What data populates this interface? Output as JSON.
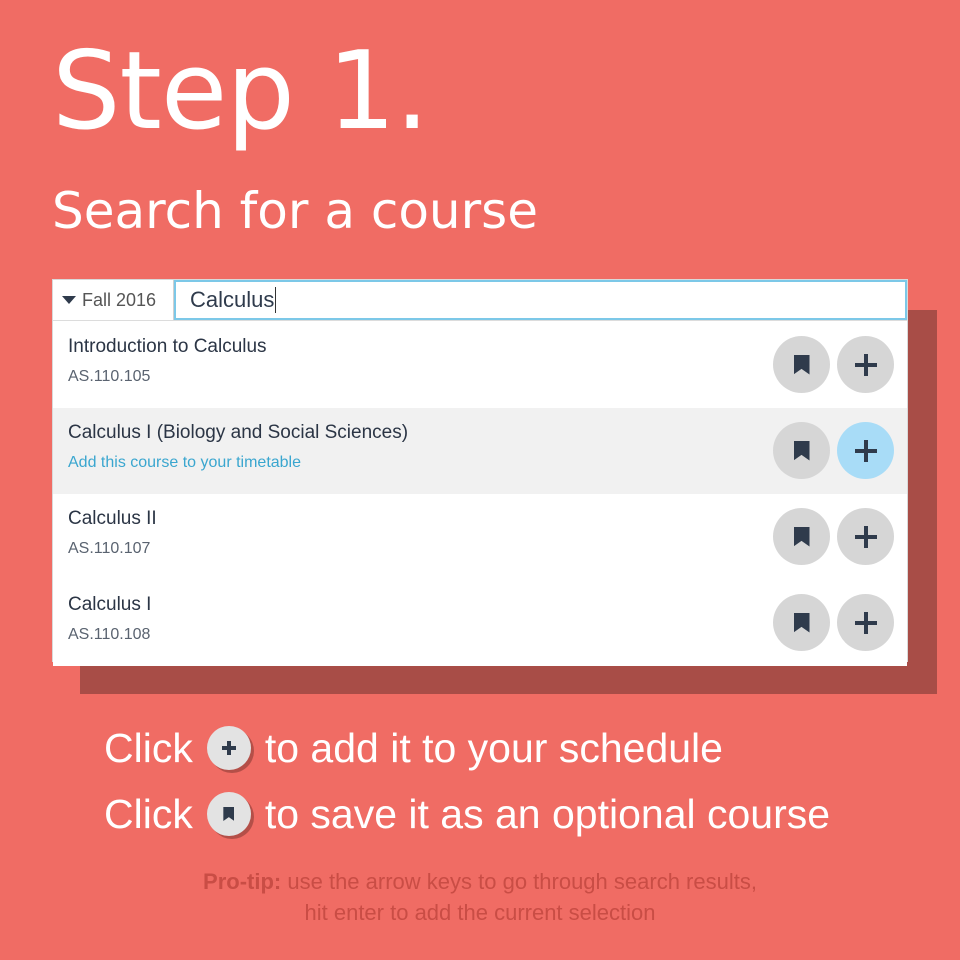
{
  "heading": {
    "title": "Step 1.",
    "subtitle": "Search for a course"
  },
  "search": {
    "term": "Fall 2016",
    "query": "Calculus"
  },
  "results": [
    {
      "title": "Introduction to Calculus",
      "code": "AS.110.105"
    },
    {
      "title": "Calculus I (Biology and Social Sciences)",
      "code": "Add this course to your timetable"
    },
    {
      "title": "Calculus II",
      "code": "AS.110.107"
    },
    {
      "title": "Calculus I",
      "code": "AS.110.108"
    }
  ],
  "instructions": {
    "add": {
      "prefix": "Click",
      "text": "to add it to your schedule"
    },
    "save": {
      "prefix": "Click",
      "text": "to save it as an optional course"
    }
  },
  "tip": {
    "label": "Pro-tip:",
    "line1": "use the arrow keys to go through search results,",
    "line2": "hit enter to add the current selection"
  },
  "icons": {
    "term_dropdown": "caret-down-icon",
    "save": "bookmark-icon",
    "add": "plus-icon"
  },
  "colors": {
    "background": "#f06c64",
    "panel_shadow": "#a84d47",
    "active_add": "#a8dcf7",
    "active_hint": "#3aa6cf"
  }
}
